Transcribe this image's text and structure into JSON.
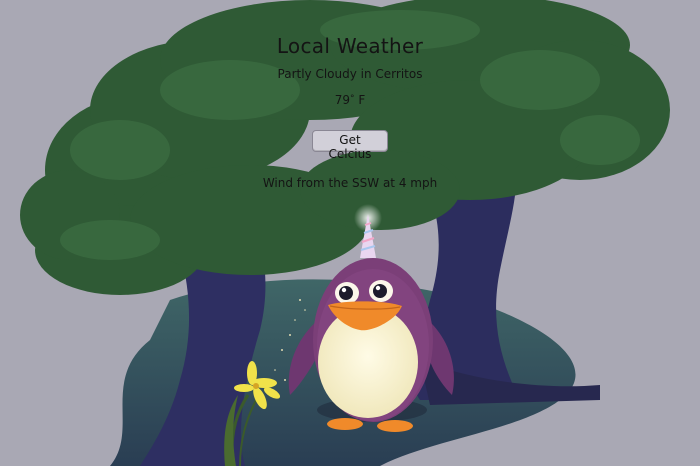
{
  "weather": {
    "title": "Local Weather",
    "condition": "Partly Cloudy in Cerritos",
    "temperature_value": "79",
    "temperature_degree": "°",
    "temperature_unit": "F",
    "toggle_button_label": "Get Celcius",
    "wind": "Wind from the SSW at 4 mph"
  },
  "scene": {
    "background_color": "#a9a8b4",
    "foliage_color": "#2f5a35",
    "trunk_color": "#2e2f62",
    "ground_color": "#2e4d58",
    "penguin_body_color": "#7b3f78",
    "penguin_belly_color": "#f6f0cf",
    "beak_color": "#f08a2a",
    "flower_color": "#f1e24a"
  }
}
